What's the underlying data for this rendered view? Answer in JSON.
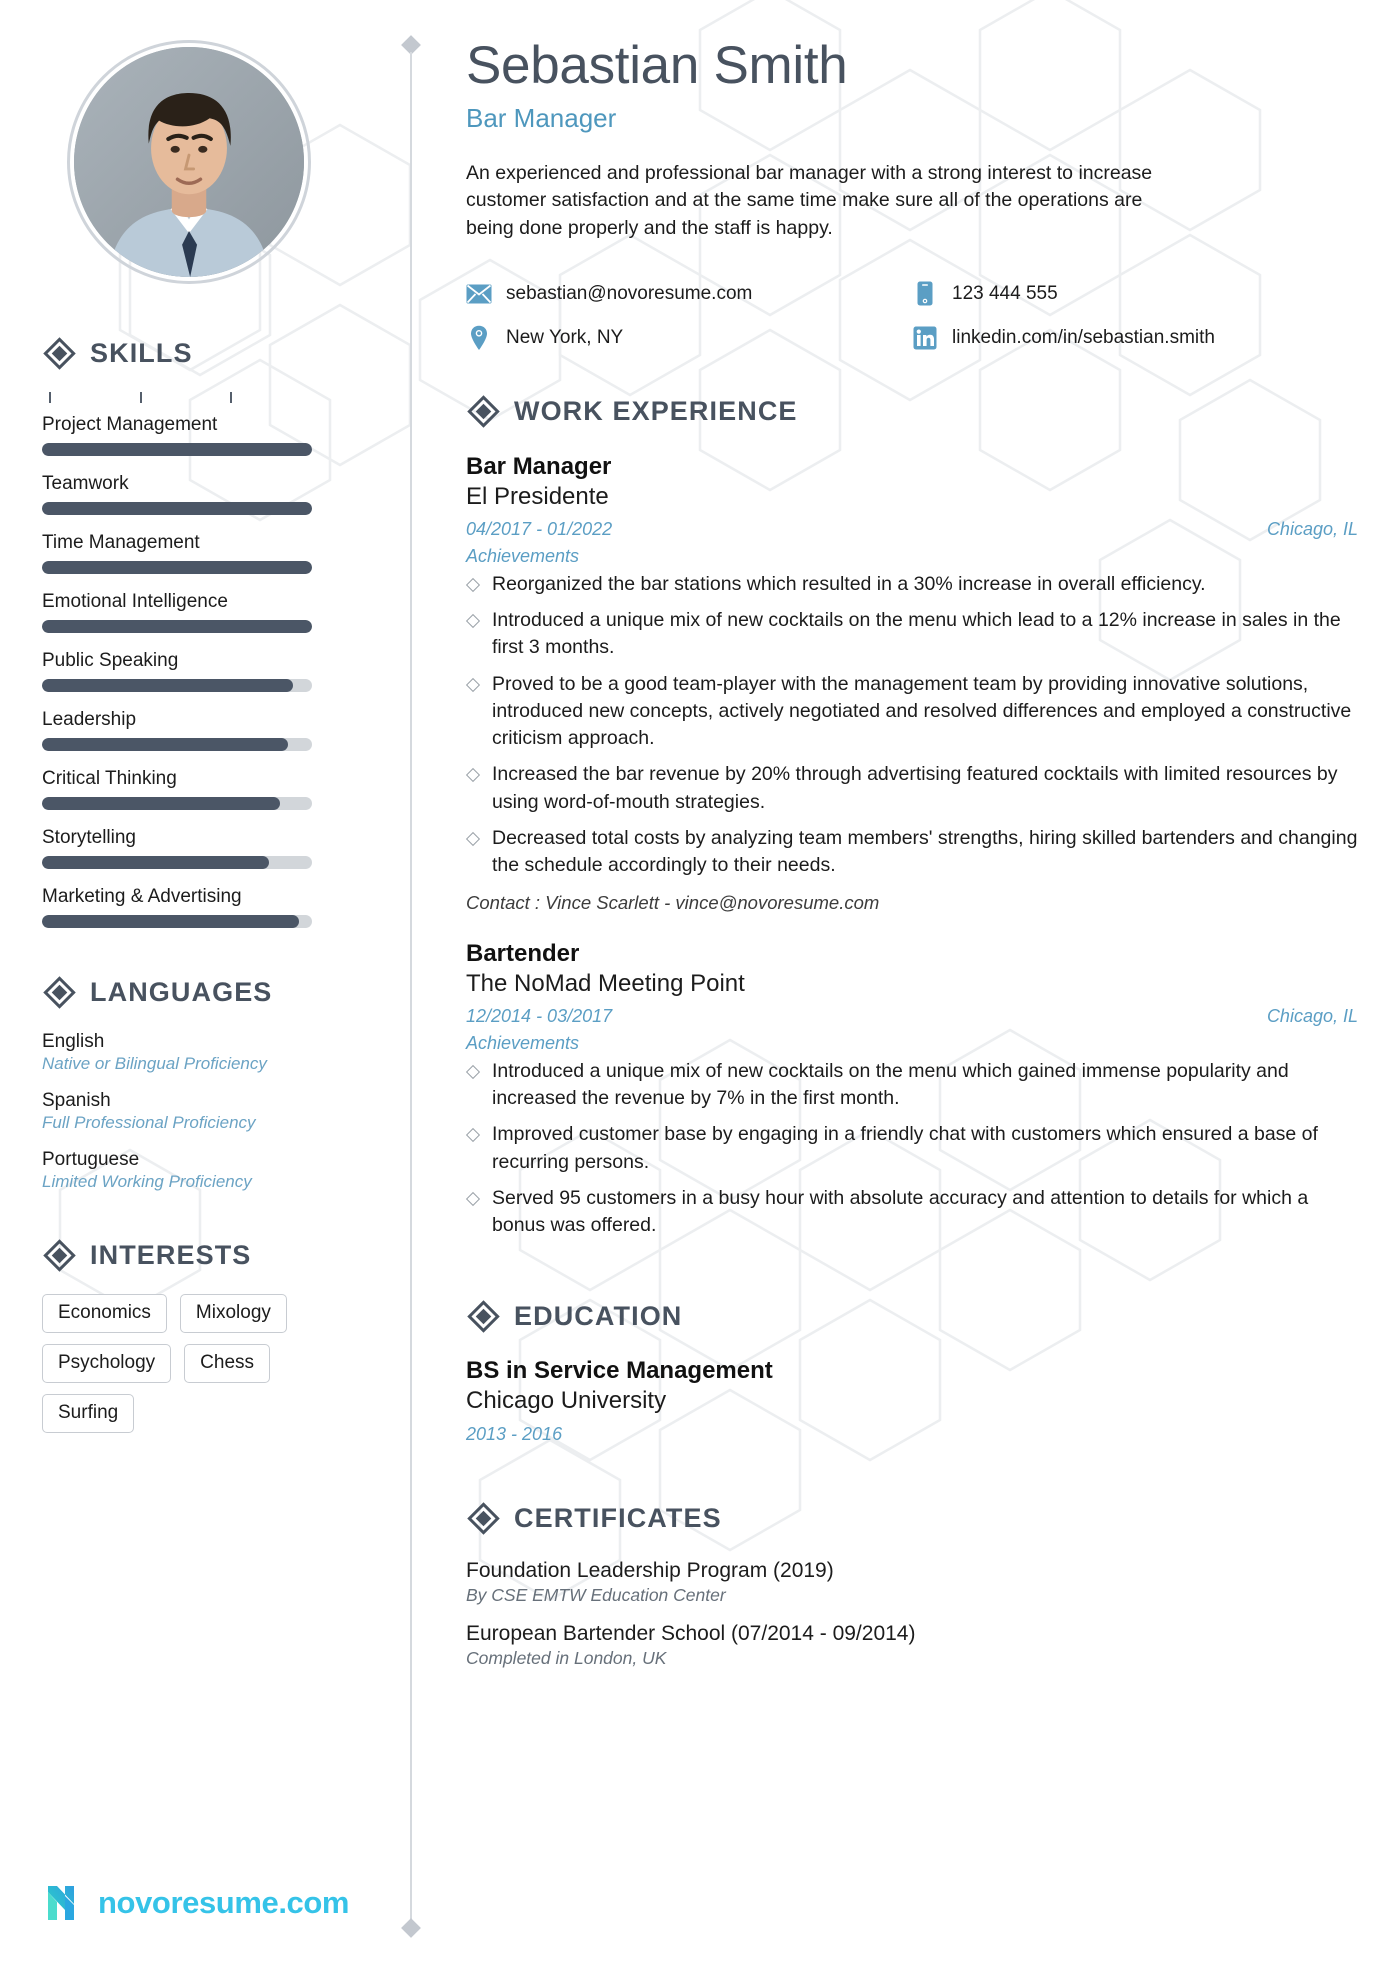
{
  "theme": {
    "dark": "#48525f",
    "accent": "#4e97bd",
    "light_accent": "#5b9ec4",
    "bar_fill": "#4b5666",
    "bar_track": "#d2d6da",
    "logo": "#35c3e8"
  },
  "header": {
    "name": "Sebastian Smith",
    "title": "Bar Manager",
    "summary": "An experienced and professional bar manager with a strong interest to increase customer satisfaction and at the same time make sure all of the operations are being done properly and the staff is happy.",
    "contacts": [
      {
        "icon": "envelope-icon",
        "value": "sebastian@novoresume.com"
      },
      {
        "icon": "phone-icon",
        "value": "123 444 555"
      },
      {
        "icon": "location-pin-icon",
        "value": "New York, NY"
      },
      {
        "icon": "linkedin-icon",
        "value": "linkedin.com/in/sebastian.smith"
      }
    ]
  },
  "sidebar": {
    "skills": {
      "heading": "SKILLS",
      "items": [
        {
          "label": "Project Management",
          "level": 100
        },
        {
          "label": "Teamwork",
          "level": 100
        },
        {
          "label": "Time Management",
          "level": 100
        },
        {
          "label": "Emotional Intelligence",
          "level": 100
        },
        {
          "label": "Public Speaking",
          "level": 93
        },
        {
          "label": "Leadership",
          "level": 91
        },
        {
          "label": "Critical Thinking",
          "level": 88
        },
        {
          "label": "Storytelling",
          "level": 84
        },
        {
          "label": "Marketing & Advertising",
          "level": 95
        }
      ]
    },
    "languages": {
      "heading": "LANGUAGES",
      "items": [
        {
          "name": "English",
          "level": "Native or Bilingual Proficiency"
        },
        {
          "name": "Spanish",
          "level": "Full Professional Proficiency"
        },
        {
          "name": "Portuguese",
          "level": "Limited Working Proficiency"
        }
      ]
    },
    "interests": {
      "heading": "INTERESTS",
      "items": [
        "Economics",
        "Mixology",
        "Psychology",
        "Chess",
        "Surfing"
      ]
    },
    "footer_logo_text": "novoresume.com"
  },
  "main": {
    "work": {
      "heading": "WORK EXPERIENCE",
      "jobs": [
        {
          "title": "Bar Manager",
          "company": "El Presidente",
          "dates": "04/2017 - 01/2022",
          "location": "Chicago, IL",
          "achievements_label": "Achievements",
          "bullets": [
            "Reorganized the bar stations which resulted in a 30% increase in overall efficiency.",
            "Introduced a unique mix of new cocktails on the menu which lead to a 12% increase in sales in the first 3 months.",
            "Proved to be a good team-player with the management team by providing innovative solutions, introduced new concepts, actively negotiated and resolved differences and employed a constructive criticism approach.",
            "Increased the bar revenue by 20% through advertising featured cocktails with limited resources by using word-of-mouth strategies.",
            "Decreased total costs by analyzing team members' strengths, hiring skilled bartenders and changing the schedule accordingly to their needs."
          ],
          "contact": "Contact :  Vince Scarlett  -  vince@novoresume.com"
        },
        {
          "title": "Bartender",
          "company": "The NoMad Meeting Point",
          "dates": "12/2014 - 03/2017",
          "location": "Chicago, IL",
          "achievements_label": "Achievements",
          "bullets": [
            "Introduced a unique mix of new cocktails on the menu which gained immense popularity and increased the revenue by 7% in the first month.",
            "Improved customer base by engaging in a friendly chat with customers which ensured a base of recurring persons.",
            "Served 95 customers in a busy hour with absolute accuracy and attention to details for which a bonus was offered."
          ],
          "contact": ""
        }
      ]
    },
    "education": {
      "heading": "EDUCATION",
      "items": [
        {
          "degree": "BS in Service Management",
          "school": "Chicago University",
          "dates": "2013 - 2016"
        }
      ]
    },
    "certificates": {
      "heading": "CERTIFICATES",
      "items": [
        {
          "name": "Foundation Leadership Program (2019)",
          "sub": "By CSE EMTW Education Center"
        },
        {
          "name": "European Bartender School (07/2014 - 09/2014)",
          "sub": "Completed in London, UK"
        }
      ]
    }
  }
}
